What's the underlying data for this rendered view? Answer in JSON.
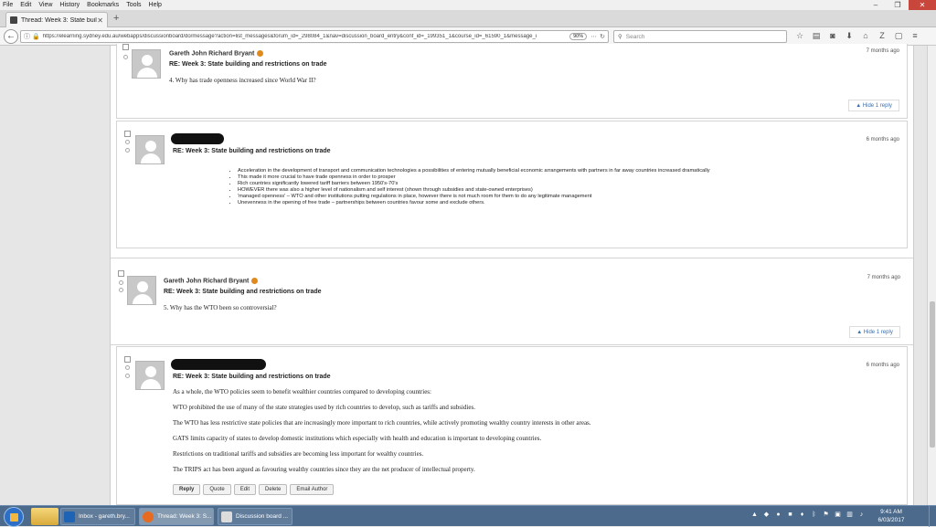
{
  "menu": [
    "File",
    "Edit",
    "View",
    "History",
    "Bookmarks",
    "Tools",
    "Help"
  ],
  "tab": {
    "title": "Thread: Week 3: State build..."
  },
  "nav": {
    "url": "https://elearning.sydney.edu.au/webapps/discussionboard/do/message?action=list_messages&forum_id=_298084_1&nav=discussion_board_entry&conf_id=_199351_1&course_id=_61590_1&message_i",
    "zoom": "90%",
    "search_placeholder": "Search"
  },
  "posts": [
    {
      "author": "Gareth John Richard Bryant",
      "subject": "RE: Week 3: State building and restrictions on trade",
      "age": "7 months ago",
      "body": "4. Why has trade openness increased since World War II?",
      "reply_link": "Hide 1 reply"
    },
    {
      "subject": "RE: Week 3: State building and restrictions on trade",
      "age": "6 months ago",
      "bullets": [
        "Acceleration in the development of transport and communication technologies a possibilities of entering mutually beneficial economic arrangements with partners in far away countries increased dramatically",
        "This made it more crucial to have trade openness in order to prosper",
        "Rich countries significantly lowered tariff barriers between 1950's-70's",
        "HOWEVER there was also a higher level of nationalism and self interest (shown through subsidies and state-owned enterprises)",
        "'managed openness' – WTO and other institutions putting regulations in place, however there is not much room for them to do any legitimate management",
        "Unevenness in the opening of free trade – partnerships between countries favour some and exclude others."
      ]
    },
    {
      "author": "Gareth John Richard Bryant",
      "subject": "RE: Week 3: State building and restrictions on trade",
      "age": "7 months ago",
      "body": "5. Why has the WTO been so controversial?",
      "reply_link": "Hide 1 reply"
    },
    {
      "subject": "RE: Week 3: State building and restrictions on trade",
      "age": "6 months ago",
      "paragraphs": [
        "As a whole, the WTO policies seem to benefit wealthier countries compared to developing countries:",
        "WTO prohibited the use of many of the state strategies used by rich countries to develop, such as tariffs and subsidies.",
        "The WTO has less restrictive state policies that are increasingly more important to rich countries, while actively promoting wealthy country interests in other areas.",
        "GATS limits capacity of states to develop domestic institutions which especially with health and education is important to developing countries.",
        "Restrictions on traditional tariffs and subsidies are becoming less important for wealthy countries.",
        "The TRIPS act has been argued as favouring wealthy countries since they are the net producer of intellectual property."
      ],
      "actions": [
        "Reply",
        "Quote",
        "Edit",
        "Delete",
        "Email Author"
      ]
    }
  ],
  "taskbar": {
    "tasks": [
      "Inbox - gareth.bry...",
      "Thread: Week 3: S...",
      "Discussion board ..."
    ],
    "time": "9:41 AM",
    "date": "6/03/2017"
  },
  "colors": {
    "link": "#3a6fb0",
    "badge": "#e08a1e",
    "taskbar": "#4b6a8c"
  }
}
